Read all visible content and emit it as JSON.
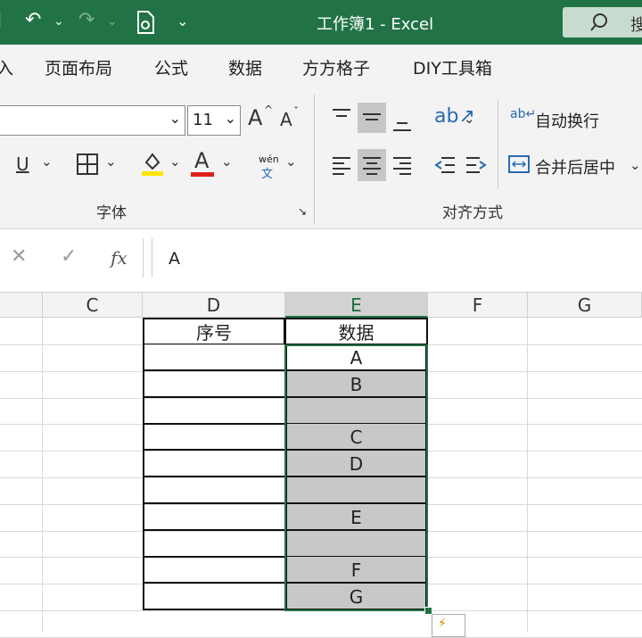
{
  "titlebar": {
    "title": "工作簿1  -  Excel",
    "search_label": "搜",
    "undo_icon": "↶",
    "redo_icon": "↷",
    "dropdown_glyph": "⌄"
  },
  "menu": {
    "tabs": [
      "入",
      "页面布局",
      "公式",
      "数据",
      "方方格子",
      "DIY工具箱"
    ]
  },
  "ribbon": {
    "font_name": "",
    "font_size": "11",
    "grow_font": "A",
    "shrink_font": "A",
    "underline": "U",
    "font_color_letter": "A",
    "phonetic_top": "wén",
    "phonetic_bottom": "文",
    "wrap_text": "自动换行",
    "merge_center": "合并后居中",
    "group_font": "字体",
    "group_alignment": "对齐方式",
    "colors": {
      "highlight": "#ffe500",
      "font_red": "#e0201b",
      "accent": "#217346"
    }
  },
  "formula_bar": {
    "cancel": "✕",
    "enter": "✓",
    "fx": "fx",
    "value": "A"
  },
  "sheet": {
    "columns": [
      "C",
      "D",
      "E",
      "F",
      "G"
    ],
    "selected_column": "E",
    "header_row": {
      "D": "序号",
      "E": "数据"
    },
    "e_values": [
      "A",
      "B",
      "",
      "C",
      "D",
      "",
      "E",
      "",
      "F",
      "G"
    ]
  }
}
